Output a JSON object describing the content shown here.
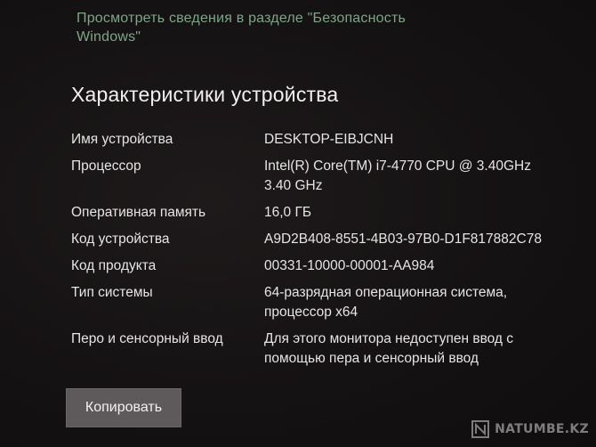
{
  "security_link": {
    "text": "Просмотреть сведения в разделе \"Безопасность Windows\""
  },
  "device_specs": {
    "title": "Характеристики устройства",
    "rows": [
      {
        "label": "Имя устройства",
        "value": "DESKTOP-EIBJCNH"
      },
      {
        "label": "Процессор",
        "value": "Intel(R) Core(TM) i7-4770 CPU @ 3.40GHz 3.40 GHz"
      },
      {
        "label": "Оперативная память",
        "value": "16,0 ГБ"
      },
      {
        "label": "Код устройства",
        "value": "A9D2B408-8551-4B03-97B0-D1F817882C78"
      },
      {
        "label": "Код продукта",
        "value": "00331-10000-00001-AA984"
      },
      {
        "label": "Тип системы",
        "value": "64-разрядная операционная система, процессор x64"
      },
      {
        "label": "Перо и сенсорный ввод",
        "value": "Для этого монитора недоступен ввод с помощью пера и сенсорный ввод"
      }
    ]
  },
  "copy_button": {
    "label": "Копировать"
  },
  "watermark": {
    "text": "NATUMBE.KZ"
  }
}
